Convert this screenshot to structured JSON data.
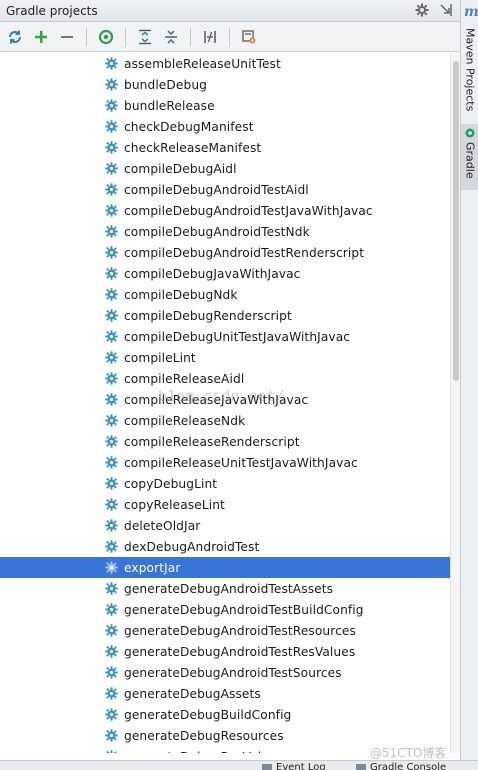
{
  "panel": {
    "title": "Gradle projects"
  },
  "right_strip": {
    "maven_label": "Maven Projects",
    "gradle_label": "Gradle",
    "m_glyph": "m"
  },
  "toolbar": {
    "icons": [
      "refresh-icon",
      "add-icon",
      "remove-icon",
      "execute-task-icon",
      "expand-all-icon",
      "collapse-all-icon",
      "toggle-offline-icon",
      "gradle-settings-icon"
    ]
  },
  "tasks": [
    {
      "label": "assembleReleaseUnitTest"
    },
    {
      "label": "bundleDebug"
    },
    {
      "label": "bundleRelease"
    },
    {
      "label": "checkDebugManifest"
    },
    {
      "label": "checkReleaseManifest"
    },
    {
      "label": "compileDebugAidl"
    },
    {
      "label": "compileDebugAndroidTestAidl"
    },
    {
      "label": "compileDebugAndroidTestJavaWithJavac"
    },
    {
      "label": "compileDebugAndroidTestNdk"
    },
    {
      "label": "compileDebugAndroidTestRenderscript"
    },
    {
      "label": "compileDebugJavaWithJavac"
    },
    {
      "label": "compileDebugNdk"
    },
    {
      "label": "compileDebugRenderscript"
    },
    {
      "label": "compileDebugUnitTestJavaWithJavac"
    },
    {
      "label": "compileLint"
    },
    {
      "label": "compileReleaseAidl"
    },
    {
      "label": "compileReleaseJavaWithJavac"
    },
    {
      "label": "compileReleaseNdk"
    },
    {
      "label": "compileReleaseRenderscript"
    },
    {
      "label": "compileReleaseUnitTestJavaWithJavac"
    },
    {
      "label": "copyDebugLint"
    },
    {
      "label": "copyReleaseLint"
    },
    {
      "label": "deleteOldJar"
    },
    {
      "label": "dexDebugAndroidTest"
    },
    {
      "label": "exportJar",
      "selected": true
    },
    {
      "label": "generateDebugAndroidTestAssets"
    },
    {
      "label": "generateDebugAndroidTestBuildConfig"
    },
    {
      "label": "generateDebugAndroidTestResources"
    },
    {
      "label": "generateDebugAndroidTestResValues"
    },
    {
      "label": "generateDebugAndroidTestSources"
    },
    {
      "label": "generateDebugAssets"
    },
    {
      "label": "generateDebugBuildConfig"
    },
    {
      "label": "generateDebugResources"
    },
    {
      "label": "generateDebugResValues"
    }
  ],
  "bottom_bar": {
    "event_log": "Event Log",
    "gradle_console": "Gradle Console"
  },
  "watermarks": {
    "url": "b1og.csdn.net/",
    "corner": "@51CTO博客"
  },
  "colors": {
    "selection": "#3875d7",
    "gear": "#3d8fc7"
  }
}
